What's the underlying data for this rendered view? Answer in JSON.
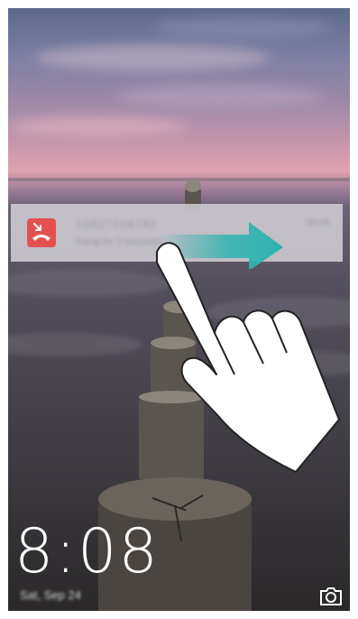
{
  "lock_screen": {
    "clock": {
      "time": "8:08",
      "date": "Sat, Sep 24"
    },
    "notification": {
      "app_icon": "missed-call-icon",
      "title": "15827256782",
      "subtitle": "Rang for 2 seconds",
      "time": "08:08"
    },
    "gesture": {
      "type": "swipe-right",
      "arrow_color": "#2fb3b0"
    },
    "shortcut": {
      "icon": "camera-icon"
    }
  },
  "colors": {
    "notification_accent": "#e45050",
    "arrow": "#2fb3b0"
  }
}
